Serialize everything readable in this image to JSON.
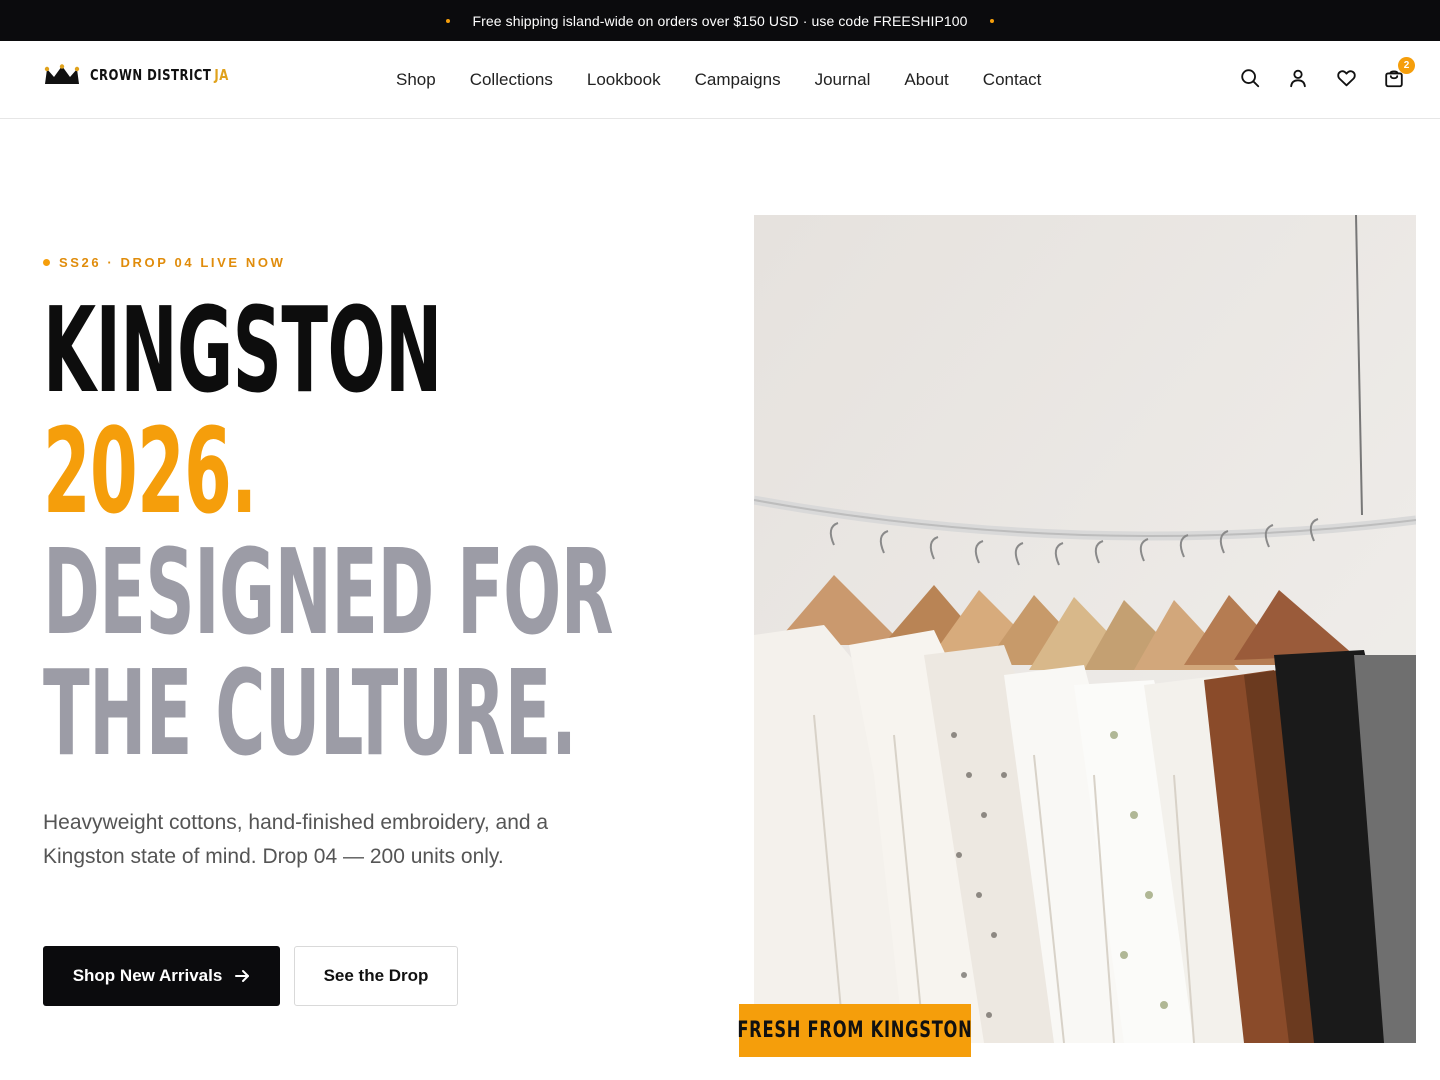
{
  "announcement": {
    "text": "Free shipping island-wide on orders over $150 USD · use code FREESHIP100"
  },
  "brand": {
    "name": "CROWN DISTRICT",
    "suffix": "JA",
    "accent": "#f59e0b"
  },
  "nav": {
    "items": [
      "Shop",
      "Collections",
      "Lookbook",
      "Campaigns",
      "Journal",
      "About",
      "Contact"
    ]
  },
  "header_icons": {
    "search": "search-icon",
    "account": "user-icon",
    "wishlist": "heart-icon",
    "cart": "bag-icon",
    "cart_count": "2"
  },
  "hero": {
    "eyebrow": "SS26 · DROP 04 LIVE NOW",
    "headline": {
      "line1": "KINGSTON",
      "line2": "2026.",
      "line3": "DESIGNED FOR",
      "line4": "THE CULTURE."
    },
    "subcopy": "Heavyweight cottons, hand-finished embroidery, and a Kingston state of mind. Drop 04 — 200 units only.",
    "primary_cta": "Shop New Arrivals",
    "secondary_cta": "See the Drop",
    "image_tag": "FRESH FROM KINGSTON",
    "colors": {
      "headline_dark": "#0d0d0d",
      "headline_accent": "#f59e0b",
      "headline_muted": "#9c9ca6"
    }
  }
}
